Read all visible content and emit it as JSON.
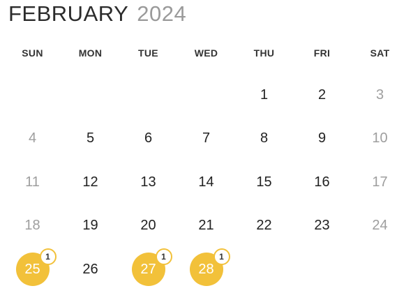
{
  "header": {
    "month": "FEBRUARY",
    "year": "2024"
  },
  "weekdays": [
    "SUN",
    "MON",
    "TUE",
    "WED",
    "THU",
    "FRI",
    "SAT"
  ],
  "weeks": [
    [
      {
        "label": "",
        "weekend": true,
        "event_count": null
      },
      {
        "label": "",
        "weekend": false,
        "event_count": null
      },
      {
        "label": "",
        "weekend": false,
        "event_count": null
      },
      {
        "label": "",
        "weekend": false,
        "event_count": null
      },
      {
        "label": "1",
        "weekend": false,
        "event_count": null
      },
      {
        "label": "2",
        "weekend": false,
        "event_count": null
      },
      {
        "label": "3",
        "weekend": true,
        "event_count": null
      }
    ],
    [
      {
        "label": "4",
        "weekend": true,
        "event_count": null
      },
      {
        "label": "5",
        "weekend": false,
        "event_count": null
      },
      {
        "label": "6",
        "weekend": false,
        "event_count": null
      },
      {
        "label": "7",
        "weekend": false,
        "event_count": null
      },
      {
        "label": "8",
        "weekend": false,
        "event_count": null
      },
      {
        "label": "9",
        "weekend": false,
        "event_count": null
      },
      {
        "label": "10",
        "weekend": true,
        "event_count": null
      }
    ],
    [
      {
        "label": "11",
        "weekend": true,
        "event_count": null
      },
      {
        "label": "12",
        "weekend": false,
        "event_count": null
      },
      {
        "label": "13",
        "weekend": false,
        "event_count": null
      },
      {
        "label": "14",
        "weekend": false,
        "event_count": null
      },
      {
        "label": "15",
        "weekend": false,
        "event_count": null
      },
      {
        "label": "16",
        "weekend": false,
        "event_count": null
      },
      {
        "label": "17",
        "weekend": true,
        "event_count": null
      }
    ],
    [
      {
        "label": "18",
        "weekend": true,
        "event_count": null
      },
      {
        "label": "19",
        "weekend": false,
        "event_count": null
      },
      {
        "label": "20",
        "weekend": false,
        "event_count": null
      },
      {
        "label": "21",
        "weekend": false,
        "event_count": null
      },
      {
        "label": "22",
        "weekend": false,
        "event_count": null
      },
      {
        "label": "23",
        "weekend": false,
        "event_count": null
      },
      {
        "label": "24",
        "weekend": true,
        "event_count": null
      }
    ],
    [
      {
        "label": "25",
        "weekend": true,
        "event_count": "1"
      },
      {
        "label": "26",
        "weekend": false,
        "event_count": null
      },
      {
        "label": "27",
        "weekend": false,
        "event_count": "1"
      },
      {
        "label": "28",
        "weekend": false,
        "event_count": "1"
      },
      {
        "label": "",
        "weekend": false,
        "event_count": null
      },
      {
        "label": "",
        "weekend": false,
        "event_count": null
      },
      {
        "label": "",
        "weekend": true,
        "event_count": null
      }
    ]
  ],
  "colors": {
    "event_highlight": "#f2c13a",
    "weekend_text": "#9e9e9e",
    "weekday_text": "#222222",
    "year_text": "#9a9a9a"
  }
}
